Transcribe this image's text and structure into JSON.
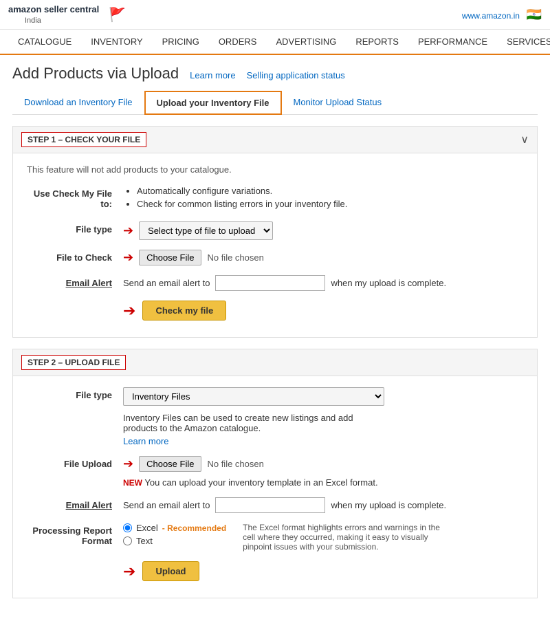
{
  "header": {
    "logo_line1": "amazon seller central",
    "logo_line2": "India",
    "flag": "🇮🇳",
    "website": "www.amazon.in"
  },
  "nav": {
    "items": [
      "CATALOGUE",
      "INVENTORY",
      "PRICING",
      "ORDERS",
      "ADVERTISING",
      "REPORTS",
      "PERFORMANCE",
      "SERVICES"
    ]
  },
  "page": {
    "title": "Add Products via Upload",
    "learn_more": "Learn more",
    "selling_status": "Selling application status"
  },
  "tabs": [
    {
      "label": "Download an Inventory File",
      "active": false
    },
    {
      "label": "Upload your Inventory File",
      "active": true
    },
    {
      "label": "Monitor Upload Status",
      "active": false
    }
  ],
  "step1": {
    "label": "STEP 1 – CHECK YOUR FILE",
    "feature_note": "This feature will not add products to your catalogue.",
    "use_check_label": "Use Check My File to:",
    "bullets": [
      "Automatically configure variations.",
      "Check for common listing errors in your inventory file."
    ],
    "file_type_label": "File type",
    "file_type_placeholder": "Select type of file to upload",
    "file_to_check_label": "File to Check",
    "choose_file_btn": "Choose File",
    "no_file_text": "No file chosen",
    "email_alert_label": "Email Alert",
    "email_send_text": "Send an email alert to",
    "email_when_text": "when my upload is complete.",
    "check_btn": "Check my file"
  },
  "step2": {
    "label": "STEP 2 – UPLOAD FILE",
    "file_type_label": "File type",
    "file_type_value": "Inventory Files",
    "inventory_desc": "Inventory Files can be used to create new listings and add products to the Amazon catalogue.",
    "learn_more": "Learn more",
    "file_upload_label": "File Upload",
    "choose_file_btn": "Choose File",
    "no_file_text": "No file chosen",
    "new_badge": "NEW",
    "new_text": "You can upload your inventory template in an Excel format.",
    "email_alert_label": "Email Alert",
    "email_send_text": "Send an email alert to",
    "email_when_text": "when my upload is complete.",
    "processing_label": "Processing Report Format",
    "excel_label": "Excel",
    "recommended": "- Recommended",
    "text_label": "Text",
    "excel_desc": "The Excel format highlights errors and warnings in the cell where they occurred, making it easy to visually pinpoint issues with your submission.",
    "upload_btn": "Upload"
  }
}
